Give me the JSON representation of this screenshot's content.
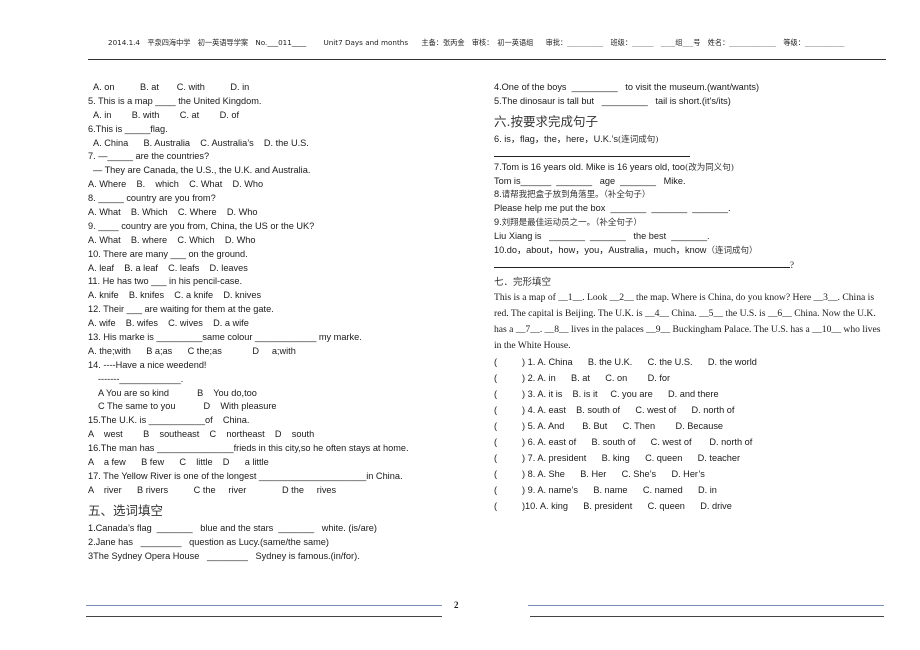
{
  "header": {
    "date": "2014.1.4",
    "school": "平泉四海中学",
    "doc_type": "初一英语导学案",
    "no_label": "No.",
    "no_value": "___011____",
    "unit": "Unit7 Days and months",
    "prepared_by": "主备：张丙金",
    "reviewed_label": "审核：",
    "reviewed_value": "初一英语组",
    "approved": "审批：__________",
    "class": "班级：______",
    "group": "____组___号",
    "name": "姓名：_____________",
    "grade": "等级：___________"
  },
  "left": {
    "lines": [
      {
        "text": "A. on          B. at       C. with          D. in",
        "indent": 1
      },
      {
        "text": "5. This is a map ____ the United Kingdom.",
        "indent": 0
      },
      {
        "text": "A. in        B. with        C. at        D. of",
        "indent": 1
      },
      {
        "text": "6.This is _____flag.",
        "indent": 0
      },
      {
        "text": "A. China      B. Australia    C. Australia’s    D. the U.S.",
        "indent": 1
      },
      {
        "text": "7. —_____ are the countries?",
        "indent": 0
      },
      {
        "text": "— They are Canada, the U.S., the U.K. and Australia.",
        "indent": 1
      },
      {
        "text": "A. Where    B.    which    C. What    D. Who",
        "indent": 0
      },
      {
        "text": "8. _____ country are you from?",
        "indent": 0
      },
      {
        "text": "A. What    B. Which    C. Where    D. Who",
        "indent": 0
      },
      {
        "text": "9. ____ country are you from, China, the US or the UK?",
        "indent": 0
      },
      {
        "text": "A. What    B. where    C. Which    D. Who",
        "indent": 0
      },
      {
        "text": "10. There are many ___ on the ground.",
        "indent": 0
      },
      {
        "text": "A. leaf    B. a leaf    C. leafs    D. leaves",
        "indent": 0
      },
      {
        "text": "11. He has two ___ in his pencil-case.",
        "indent": 0
      },
      {
        "text": "A. knife    B. knifes    C. a knife    D. knives",
        "indent": 0
      },
      {
        "text": "12. Their ___ are waiting for them at the gate.",
        "indent": 0
      },
      {
        "text": "A. wife    B. wifes    C. wives    D. a wife",
        "indent": 0
      },
      {
        "text": "13. His marke is _________same colour ____________ my marke.",
        "indent": 0
      },
      {
        "text": "A. the;with      B a;as      C the;as            D     a;with",
        "indent": 0
      },
      {
        "text": "14. ----Have a nice weedend!",
        "indent": 0
      },
      {
        "text": "-------____________.",
        "indent": 2
      },
      {
        "text": "A You are so kind           B    You do,too",
        "indent": 2
      },
      {
        "text": "C The same to you           D    With pleasure",
        "indent": 2
      },
      {
        "text": "15.The U.K. is ___________of    China.",
        "indent": 0
      },
      {
        "text": "A    west        B    southeast    C    northeast    D    south",
        "indent": 0
      },
      {
        "text": "16.The man has _______________frieds in this city,so he often stays at home.",
        "indent": 0
      },
      {
        "text": "A    a few      B few      C    little    D      a little",
        "indent": 0
      },
      {
        "text": "17. The Yellow River is one of the longest _____________________in China.",
        "indent": 0
      },
      {
        "text": "A    river      B rivers          C the     river              D the     rives",
        "indent": 0
      }
    ],
    "section5_title": "五、选词填空",
    "section5_lines": [
      "1.Canada’s flag  _______   blue and the stars  _______   white. (is/are)",
      "2.Jane has   ________   question as Lucy.(same/the same)",
      "3The Sydney Opera House   ________   Sydney is famous.(in/for)."
    ]
  },
  "right": {
    "section5_cont": [
      "4.One of the boys  _________   to visit the museum.(want/wants)",
      "5.The dinosaur is tall but   _________   tail is short.(it’s/its)"
    ],
    "section6_title": "六.按要求完成句子",
    "q6": "6. is，flag，the，here，U.K.’s",
    "q6_hint": "(连词成句)",
    "q7": "7.Tom is 16 years old. Mike is 16 years old, too",
    "q7_hint": "(改为同义句)",
    "q7_answer": "Tom is______  _______   age  _______   Mike.",
    "q8": "8.",
    "q8_cn": "请帮我把盒子放到角落里。（补全句子）",
    "q8_answer": "Please help me put the box  _______  _______  _______.",
    "q9": "9.",
    "q9_cn": "刘翔是最佳运动员之一。（补全句子）",
    "q9_answer": "Liu Xiang is   _______  _______   the best  _______.",
    "q10": "10.do，about，how，you，Australia，much，know",
    "q10_hint": "（连词成句）",
    "q10_end": "?",
    "section7_title": "七．完形填空",
    "passage": "This is a map of __1__. Look __2__ the map. Where is China, do you know? Here __3__. China is red. The capital is Beijing. The U.K. is __4__ China. __5__ the U.S. is __6__ China. Now the U.K. has a __7__. __8__ lives in the palaces __9__ Buckingham Palace. The U.S. has a __10__ who lives in the White House.",
    "cloze": [
      {
        "paren": "(",
        "text": ") 1. A. China      B. the U.K.      C. the U.S.      D. the world"
      },
      {
        "paren": "(",
        "text": ") 2. A. in      B. at      C. on        D. for"
      },
      {
        "paren": "(",
        "text": ") 3. A. it is    B. is it     C. you are      D. and there"
      },
      {
        "paren": "(",
        "text": ") 4. A. east    B. south of      C. west of      D. north of"
      },
      {
        "paren": "(",
        "text": ") 5. A. And       B. But      C. Then        D. Because"
      },
      {
        "paren": "(",
        "text": ") 6. A. east of      B. south of      C. west of       D. north of"
      },
      {
        "paren": "(",
        "text": ") 7. A. president      B. king      C. queen      D. teacher"
      },
      {
        "paren": "(",
        "text": ") 8. A. She      B. Her      C. She’s      D. Her’s"
      },
      {
        "paren": "(",
        "text": ") 9. A. name’s      B. name      C. named      D. in"
      },
      {
        "paren": "(",
        "text": ")10. A. king      B. president      C. queen      D. drive"
      }
    ]
  },
  "footer": {
    "page_number": "2"
  }
}
